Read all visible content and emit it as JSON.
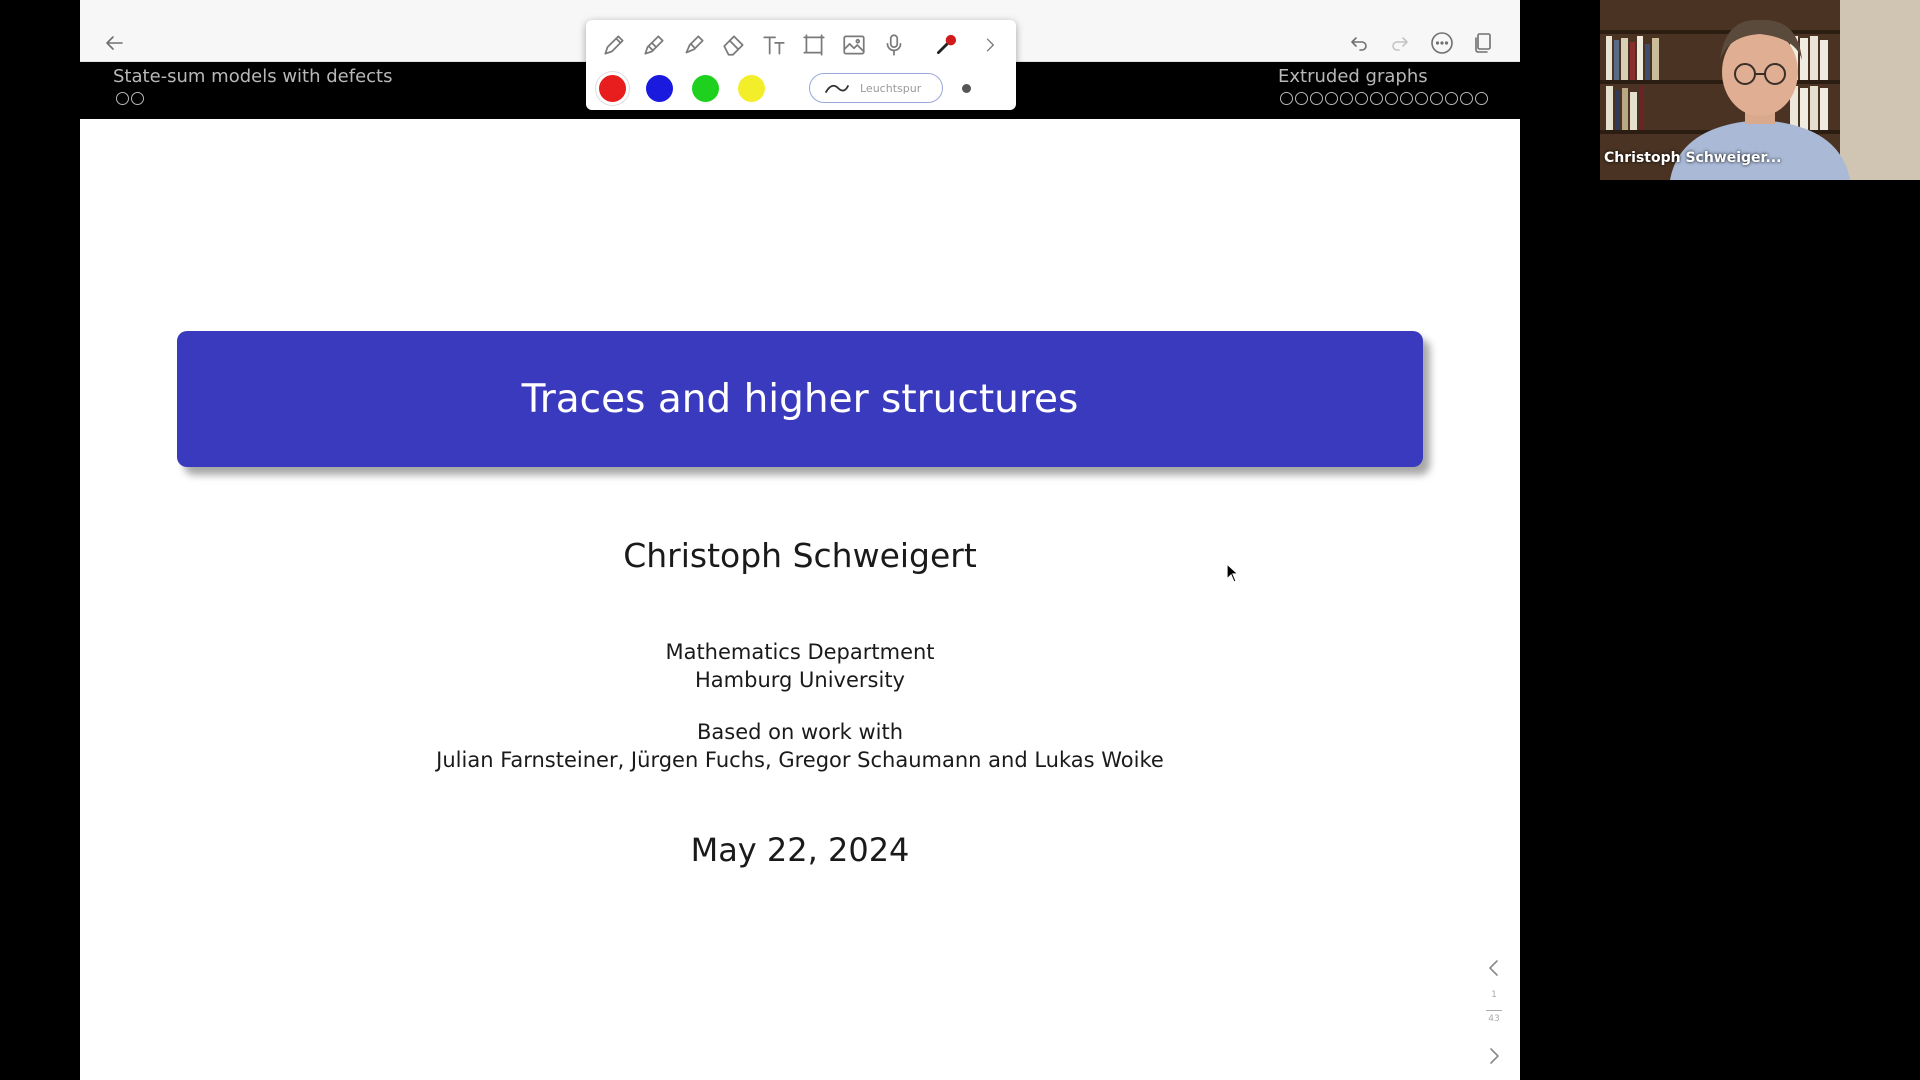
{
  "toolbar": {
    "back_icon": "arrow-left-icon",
    "right_icons": [
      "undo-icon",
      "redo-icon",
      "more-icon",
      "pages-icon"
    ]
  },
  "beamer_header": {
    "left_section": "State-sum models with defects",
    "left_dots": 2,
    "right_section": "Extruded graphs",
    "right_dots": 14
  },
  "pen_toolbar": {
    "tools": [
      "pen-icon",
      "pencil-icon",
      "highlighter-icon",
      "eraser-icon",
      "text-icon",
      "selection-icon",
      "image-icon",
      "microphone-icon",
      "laser-pointer-icon",
      "chevron-right-icon"
    ],
    "colors": [
      "#e81d1d",
      "#1a1adf",
      "#1fd11f",
      "#f3ee2a"
    ],
    "highlighter_label": "Leuchtspur"
  },
  "slide": {
    "title": "Traces and higher structures",
    "author": "Christoph Schweigert",
    "department": "Mathematics Department",
    "university": "Hamburg University",
    "based_on": "Based on work with",
    "coauthors": "Julian Farnsteiner, Jürgen Fuchs, Gregor Schaumann and Lukas Woike",
    "date": "May 22, 2024",
    "title_color": "#3a3abf"
  },
  "page_nav": {
    "current": "1",
    "total": "43"
  },
  "webcam": {
    "participant_name": "Christoph Schweiger..."
  }
}
